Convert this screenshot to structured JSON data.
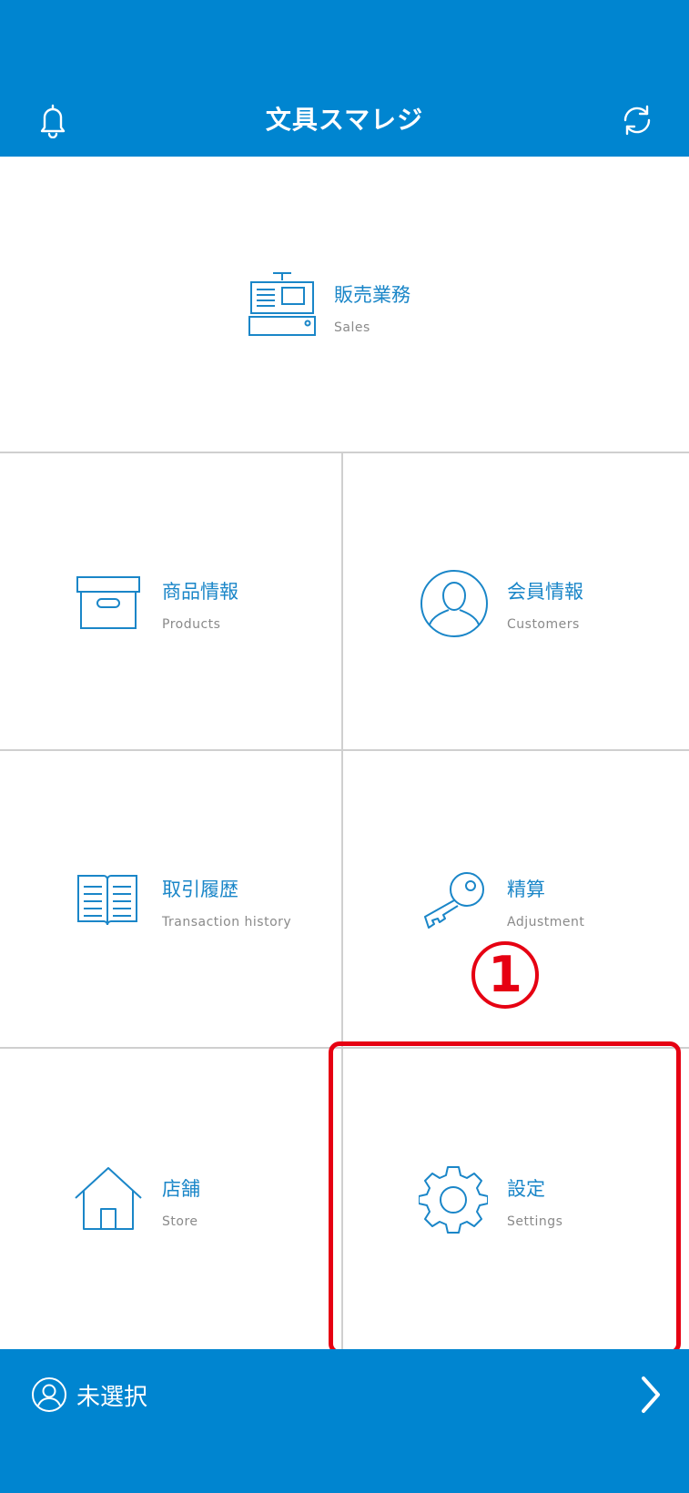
{
  "header": {
    "title": "文具スマレジ",
    "icons": {
      "left": "bell-icon",
      "right": "refresh-icon"
    }
  },
  "menu": {
    "sales": {
      "label": "販売業務",
      "sub": "Sales",
      "icon": "cash-register-icon"
    },
    "products": {
      "label": "商品情報",
      "sub": "Products",
      "icon": "box-icon"
    },
    "customers": {
      "label": "会員情報",
      "sub": "Customers",
      "icon": "user-icon"
    },
    "history": {
      "label": "取引履歴",
      "sub": "Transaction history",
      "icon": "book-icon"
    },
    "adjustment": {
      "label": "精算",
      "sub": "Adjustment",
      "icon": "key-icon"
    },
    "store": {
      "label": "店舗",
      "sub": "Store",
      "icon": "house-icon"
    },
    "settings": {
      "label": "設定",
      "sub": "Settings",
      "icon": "gear-icon"
    }
  },
  "annotation": {
    "step": "1"
  },
  "footer": {
    "staff": "未選択",
    "icons": {
      "left": "staff-icon",
      "right": "chevron-right-icon"
    }
  },
  "colors": {
    "brand": "#0085d0",
    "icon": "#1a86c8",
    "highlight": "#e60012"
  }
}
